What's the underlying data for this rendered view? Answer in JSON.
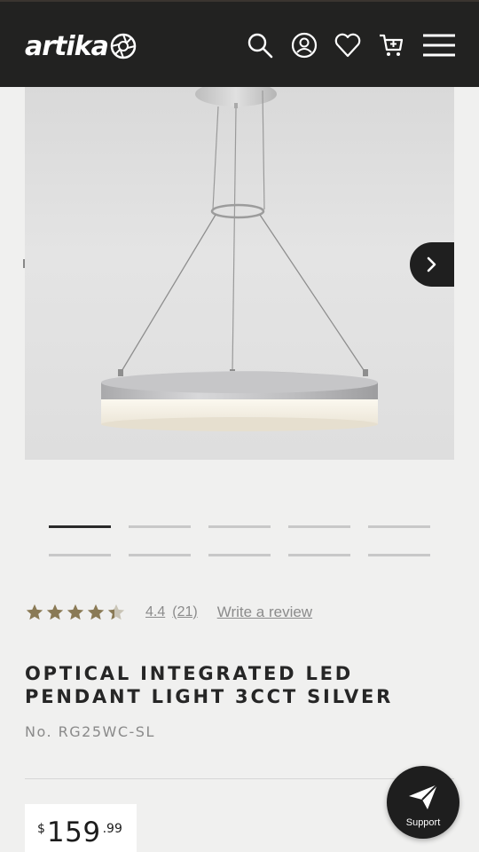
{
  "header": {
    "logo_text": "artika",
    "icons": [
      "search-icon",
      "account-icon",
      "wishlist-icon",
      "cart-icon",
      "menu-icon"
    ]
  },
  "gallery": {
    "image": "pendant-light-photo",
    "thumbnail_count": 10,
    "active_thumbnail": 1
  },
  "rating": {
    "stars": 4.4,
    "value": "4.4",
    "count": "(21)",
    "write_review": "Write a review"
  },
  "product": {
    "title": "OPTICAL INTEGRATED LED PENDANT LIGHT 3CCT SILVER",
    "sku": "No. RG25WC-SL"
  },
  "price": {
    "currency": "$",
    "main": "159",
    "cents": ".99"
  },
  "support": {
    "label": "Support"
  },
  "colors": {
    "header_bg": "#222221",
    "page_bg": "#f0f0ef",
    "star_gold": "#8a7a55",
    "accent_dark": "#1f1f1f"
  }
}
